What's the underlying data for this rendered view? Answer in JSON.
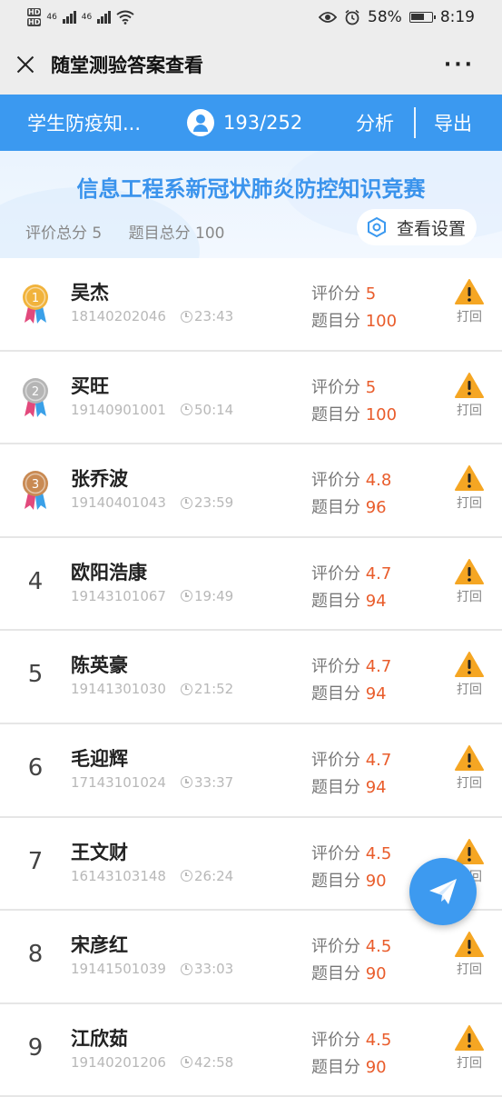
{
  "status_bar": {
    "battery": "58%",
    "time": "8:19",
    "signal1": "46",
    "signal2": "46",
    "hd1": "HD",
    "hd2": "HD"
  },
  "title_bar": {
    "title": "随堂测验答案查看",
    "more": "···"
  },
  "header": {
    "course": "学生防疫知...",
    "count": "193/252",
    "analyze": "分析",
    "export": "导出"
  },
  "info": {
    "contest_title": "信息工程系新冠状肺炎防控知识竞赛",
    "eval_total": "评价总分 5",
    "question_total": "题目总分 100",
    "view_settings": "查看设置"
  },
  "labels": {
    "eval": "评价分 ",
    "question": "题目分 ",
    "report": "打回"
  },
  "students": [
    {
      "rank": "1",
      "medal": "gold",
      "name": "吴杰",
      "id": "18140202046",
      "time": "23:43",
      "eval": "5",
      "score": "100"
    },
    {
      "rank": "2",
      "medal": "silver",
      "name": "买旺",
      "id": "19140901001",
      "time": "50:14",
      "eval": "5",
      "score": "100"
    },
    {
      "rank": "3",
      "medal": "bronze",
      "name": "张乔波",
      "id": "19140401043",
      "time": "23:59",
      "eval": "4.8",
      "score": "96"
    },
    {
      "rank": "4",
      "name": "欧阳浩康",
      "id": "19143101067",
      "time": "19:49",
      "eval": "4.7",
      "score": "94"
    },
    {
      "rank": "5",
      "name": "陈英豪",
      "id": "19141301030",
      "time": "21:52",
      "eval": "4.7",
      "score": "94"
    },
    {
      "rank": "6",
      "name": "毛迎辉",
      "id": "17143101024",
      "time": "33:37",
      "eval": "4.7",
      "score": "94"
    },
    {
      "rank": "7",
      "name": "王文财",
      "id": "16143103148",
      "time": "26:24",
      "eval": "4.5",
      "score": "90"
    },
    {
      "rank": "8",
      "name": "宋彦红",
      "id": "19141501039",
      "time": "33:03",
      "eval": "4.5",
      "score": "90"
    },
    {
      "rank": "9",
      "name": "江欣茹",
      "id": "19140201206",
      "time": "42:58",
      "eval": "4.5",
      "score": "90"
    }
  ],
  "colors": {
    "accent": "#3b99f0",
    "score": "#e95c2b",
    "warning": "#f5a623",
    "gold": "#f1b33c",
    "silver": "#b5b5b5",
    "bronze": "#c98a53"
  },
  "icons": {
    "close": "close-icon",
    "more": "more-icon",
    "person": "person-icon",
    "settings": "hexagon-settings-icon",
    "warning": "warning-icon",
    "clock": "clock-icon",
    "send": "paper-plane-icon"
  }
}
